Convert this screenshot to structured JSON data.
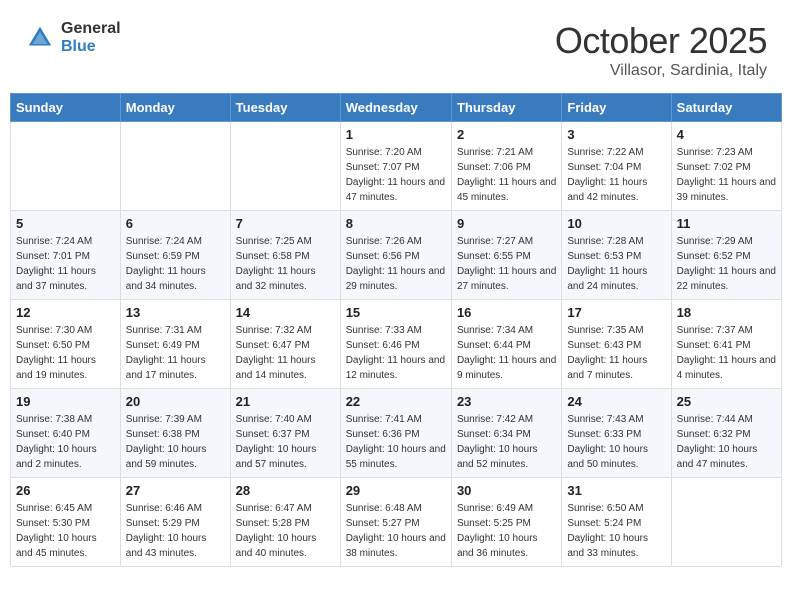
{
  "header": {
    "logo_general": "General",
    "logo_blue": "Blue",
    "month": "October 2025",
    "location": "Villasor, Sardinia, Italy"
  },
  "days_of_week": [
    "Sunday",
    "Monday",
    "Tuesday",
    "Wednesday",
    "Thursday",
    "Friday",
    "Saturday"
  ],
  "weeks": [
    [
      {
        "num": "",
        "sunrise": "",
        "sunset": "",
        "daylight": ""
      },
      {
        "num": "",
        "sunrise": "",
        "sunset": "",
        "daylight": ""
      },
      {
        "num": "",
        "sunrise": "",
        "sunset": "",
        "daylight": ""
      },
      {
        "num": "1",
        "sunrise": "7:20 AM",
        "sunset": "7:07 PM",
        "daylight": "11 hours and 47 minutes."
      },
      {
        "num": "2",
        "sunrise": "7:21 AM",
        "sunset": "7:06 PM",
        "daylight": "11 hours and 45 minutes."
      },
      {
        "num": "3",
        "sunrise": "7:22 AM",
        "sunset": "7:04 PM",
        "daylight": "11 hours and 42 minutes."
      },
      {
        "num": "4",
        "sunrise": "7:23 AM",
        "sunset": "7:02 PM",
        "daylight": "11 hours and 39 minutes."
      }
    ],
    [
      {
        "num": "5",
        "sunrise": "7:24 AM",
        "sunset": "7:01 PM",
        "daylight": "11 hours and 37 minutes."
      },
      {
        "num": "6",
        "sunrise": "7:24 AM",
        "sunset": "6:59 PM",
        "daylight": "11 hours and 34 minutes."
      },
      {
        "num": "7",
        "sunrise": "7:25 AM",
        "sunset": "6:58 PM",
        "daylight": "11 hours and 32 minutes."
      },
      {
        "num": "8",
        "sunrise": "7:26 AM",
        "sunset": "6:56 PM",
        "daylight": "11 hours and 29 minutes."
      },
      {
        "num": "9",
        "sunrise": "7:27 AM",
        "sunset": "6:55 PM",
        "daylight": "11 hours and 27 minutes."
      },
      {
        "num": "10",
        "sunrise": "7:28 AM",
        "sunset": "6:53 PM",
        "daylight": "11 hours and 24 minutes."
      },
      {
        "num": "11",
        "sunrise": "7:29 AM",
        "sunset": "6:52 PM",
        "daylight": "11 hours and 22 minutes."
      }
    ],
    [
      {
        "num": "12",
        "sunrise": "7:30 AM",
        "sunset": "6:50 PM",
        "daylight": "11 hours and 19 minutes."
      },
      {
        "num": "13",
        "sunrise": "7:31 AM",
        "sunset": "6:49 PM",
        "daylight": "11 hours and 17 minutes."
      },
      {
        "num": "14",
        "sunrise": "7:32 AM",
        "sunset": "6:47 PM",
        "daylight": "11 hours and 14 minutes."
      },
      {
        "num": "15",
        "sunrise": "7:33 AM",
        "sunset": "6:46 PM",
        "daylight": "11 hours and 12 minutes."
      },
      {
        "num": "16",
        "sunrise": "7:34 AM",
        "sunset": "6:44 PM",
        "daylight": "11 hours and 9 minutes."
      },
      {
        "num": "17",
        "sunrise": "7:35 AM",
        "sunset": "6:43 PM",
        "daylight": "11 hours and 7 minutes."
      },
      {
        "num": "18",
        "sunrise": "7:37 AM",
        "sunset": "6:41 PM",
        "daylight": "11 hours and 4 minutes."
      }
    ],
    [
      {
        "num": "19",
        "sunrise": "7:38 AM",
        "sunset": "6:40 PM",
        "daylight": "10 hours and 2 minutes."
      },
      {
        "num": "20",
        "sunrise": "7:39 AM",
        "sunset": "6:38 PM",
        "daylight": "10 hours and 59 minutes."
      },
      {
        "num": "21",
        "sunrise": "7:40 AM",
        "sunset": "6:37 PM",
        "daylight": "10 hours and 57 minutes."
      },
      {
        "num": "22",
        "sunrise": "7:41 AM",
        "sunset": "6:36 PM",
        "daylight": "10 hours and 55 minutes."
      },
      {
        "num": "23",
        "sunrise": "7:42 AM",
        "sunset": "6:34 PM",
        "daylight": "10 hours and 52 minutes."
      },
      {
        "num": "24",
        "sunrise": "7:43 AM",
        "sunset": "6:33 PM",
        "daylight": "10 hours and 50 minutes."
      },
      {
        "num": "25",
        "sunrise": "7:44 AM",
        "sunset": "6:32 PM",
        "daylight": "10 hours and 47 minutes."
      }
    ],
    [
      {
        "num": "26",
        "sunrise": "6:45 AM",
        "sunset": "5:30 PM",
        "daylight": "10 hours and 45 minutes."
      },
      {
        "num": "27",
        "sunrise": "6:46 AM",
        "sunset": "5:29 PM",
        "daylight": "10 hours and 43 minutes."
      },
      {
        "num": "28",
        "sunrise": "6:47 AM",
        "sunset": "5:28 PM",
        "daylight": "10 hours and 40 minutes."
      },
      {
        "num": "29",
        "sunrise": "6:48 AM",
        "sunset": "5:27 PM",
        "daylight": "10 hours and 38 minutes."
      },
      {
        "num": "30",
        "sunrise": "6:49 AM",
        "sunset": "5:25 PM",
        "daylight": "10 hours and 36 minutes."
      },
      {
        "num": "31",
        "sunrise": "6:50 AM",
        "sunset": "5:24 PM",
        "daylight": "10 hours and 33 minutes."
      },
      {
        "num": "",
        "sunrise": "",
        "sunset": "",
        "daylight": ""
      }
    ]
  ],
  "labels": {
    "sunrise": "Sunrise:",
    "sunset": "Sunset:",
    "daylight": "Daylight:"
  }
}
